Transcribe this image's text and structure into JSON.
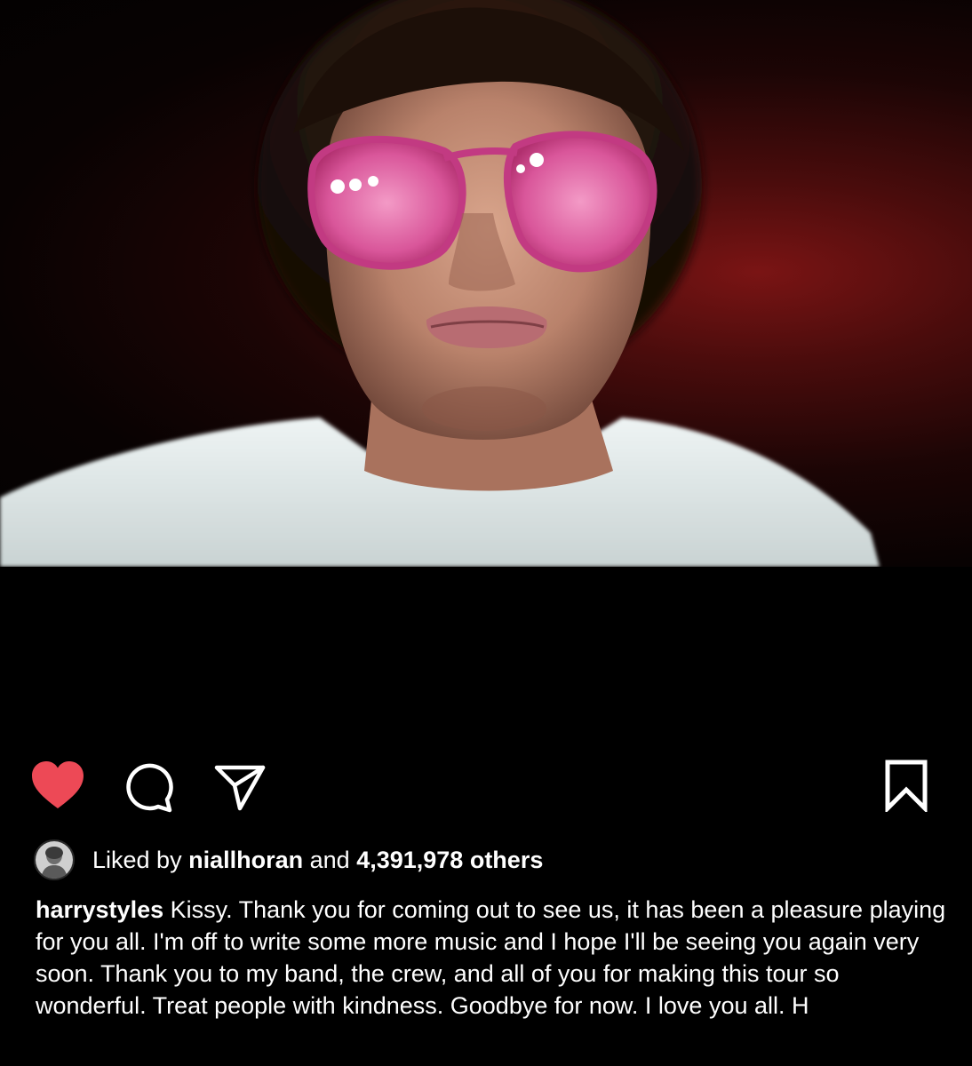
{
  "post": {
    "photo": {
      "subject": "person with pink tinted sunglasses making a pout"
    },
    "actions": {
      "like": {
        "icon": "heart-icon",
        "liked": true,
        "color": "#ed4956"
      },
      "comment": {
        "icon": "comment-icon"
      },
      "share": {
        "icon": "share-icon"
      },
      "save": {
        "icon": "bookmark-icon"
      }
    },
    "likes": {
      "prefix": "Liked by",
      "liker_username": "niallhoran",
      "connector": "and",
      "others": "4,391,978 others"
    },
    "caption": {
      "username": "harrystyles",
      "text": "Kissy. Thank you for coming out to see us, it has been a pleasure playing for you all. I'm off to write some more music and I hope I'll be seeing you again very soon. Thank you to my band, the crew, and all of you for making this tour so wonderful. Treat people with kindness. Goodbye for now. I love you all. H"
    }
  },
  "colors": {
    "background": "#000000",
    "text": "#ffffff",
    "like_red": "#ed4956"
  }
}
